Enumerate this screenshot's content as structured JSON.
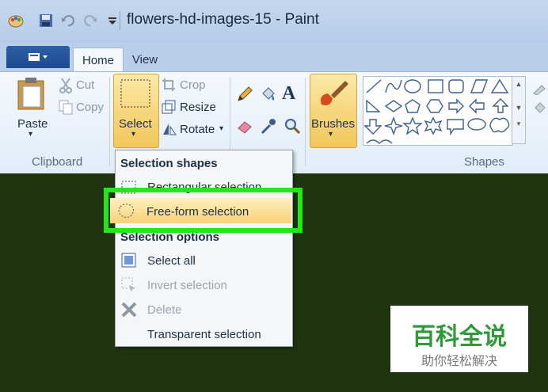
{
  "window": {
    "title": "flowers-hd-images-15 - Paint"
  },
  "quick_access": {
    "icons": [
      "paint-app-icon",
      "save-icon",
      "undo-icon",
      "redo-icon",
      "customize-qat-icon"
    ]
  },
  "tabs": [
    {
      "label": "Home"
    },
    {
      "label": "View"
    }
  ],
  "ribbon": {
    "clipboard": {
      "paste": "Paste",
      "cut": "Cut",
      "copy": "Copy",
      "group": "Clipboard"
    },
    "image": {
      "select": "Select",
      "crop": "Crop",
      "resize": "Resize",
      "rotate": "Rotate"
    },
    "brushes": {
      "label": "Brushes"
    },
    "shapes": {
      "group": "Shapes"
    }
  },
  "menu": {
    "heading1": "Selection shapes",
    "item_rect": "Rectangular selection",
    "item_free": "Free-form selection",
    "heading2": "Selection options",
    "item_all": "Select all",
    "item_invert": "Invert selection",
    "item_delete": "Delete",
    "item_transparent": "Transparent selection"
  },
  "watermark": {
    "main": "百科全说",
    "sub": "助你轻松解决"
  },
  "colors": {
    "highlight": "#27e51b",
    "canvas": "#1f3510",
    "accent": "#f2c65a"
  }
}
